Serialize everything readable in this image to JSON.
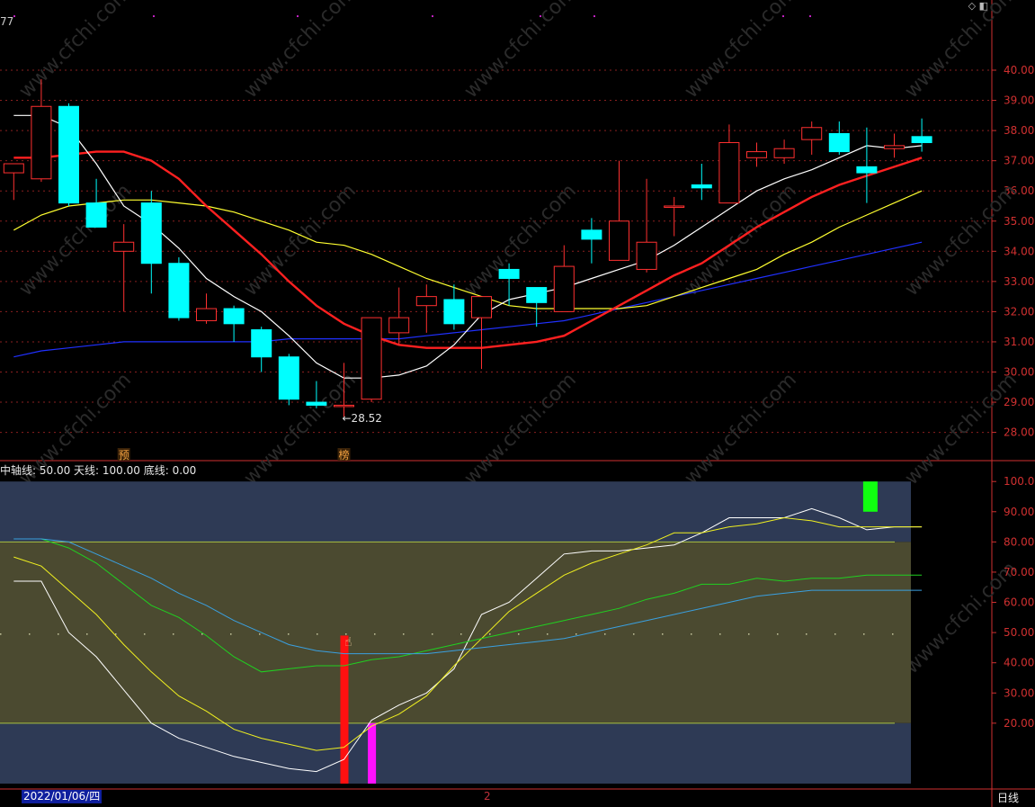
{
  "indicator_header": {
    "middle": "中轴线: 50.00",
    "top": "天线: 100.00",
    "bottom": "底线: 0.00"
  },
  "top_left_text": "77",
  "date_label": "2022/01/06/四",
  "period_label": "日线",
  "bottom_mid_label": "2",
  "window_icons": "◇ ◧",
  "watermark": "www.cfchi.com",
  "colors": {
    "up": "#ff3030",
    "down": "#00ffff",
    "ma5": "#ffffff",
    "ma10": "#ff2020",
    "ma20": "#ffff30",
    "ma60": "#2030ff",
    "grid": "#8a1f1f",
    "axis": "#d03030",
    "zone_band": "#2e3a55",
    "zone_mid": "#4b4a30"
  },
  "chart_data": [
    {
      "type": "candlestick",
      "ylim": [
        27.5,
        40.8
      ],
      "yticks": [
        "28.00",
        "29.00",
        "30.00",
        "31.00",
        "32.00",
        "33.00",
        "34.00",
        "35.00",
        "36.00",
        "37.00",
        "38.00",
        "39.00",
        "40.00"
      ],
      "candles": [
        {
          "o": 36.6,
          "h": 36.6,
          "l": 35.7,
          "c": 36.9
        },
        {
          "o": 36.4,
          "h": 39.7,
          "l": 36.3,
          "c": 38.8
        },
        {
          "o": 38.8,
          "h": 38.9,
          "l": 35.5,
          "c": 35.6
        },
        {
          "o": 35.6,
          "h": 36.4,
          "l": 34.8,
          "c": 34.8
        },
        {
          "o": 34.0,
          "h": 34.9,
          "l": 32.0,
          "c": 34.3
        },
        {
          "o": 35.6,
          "h": 36.0,
          "l": 32.6,
          "c": 33.6
        },
        {
          "o": 33.6,
          "h": 33.8,
          "l": 31.7,
          "c": 31.8
        },
        {
          "o": 31.7,
          "h": 32.6,
          "l": 31.6,
          "c": 32.1
        },
        {
          "o": 32.1,
          "h": 32.2,
          "l": 31.0,
          "c": 31.6
        },
        {
          "o": 31.4,
          "h": 31.5,
          "l": 30.0,
          "c": 30.5
        },
        {
          "o": 30.5,
          "h": 30.6,
          "l": 28.9,
          "c": 29.1
        },
        {
          "o": 29.0,
          "h": 29.7,
          "l": 28.8,
          "c": 28.9
        },
        {
          "o": 28.9,
          "h": 30.3,
          "l": 28.52,
          "c": 28.9
        },
        {
          "o": 29.1,
          "h": 31.8,
          "l": 29.0,
          "c": 31.8
        },
        {
          "o": 31.3,
          "h": 32.8,
          "l": 30.9,
          "c": 31.8
        },
        {
          "o": 32.2,
          "h": 32.9,
          "l": 31.3,
          "c": 32.5
        },
        {
          "o": 32.4,
          "h": 32.9,
          "l": 31.4,
          "c": 31.6
        },
        {
          "o": 31.8,
          "h": 32.5,
          "l": 30.1,
          "c": 32.5
        },
        {
          "o": 33.4,
          "h": 33.6,
          "l": 32.2,
          "c": 33.1
        },
        {
          "o": 32.8,
          "h": 32.8,
          "l": 31.5,
          "c": 32.3
        },
        {
          "o": 32.0,
          "h": 34.2,
          "l": 32.0,
          "c": 33.5
        },
        {
          "o": 34.7,
          "h": 35.1,
          "l": 33.6,
          "c": 34.4
        },
        {
          "o": 33.7,
          "h": 37.0,
          "l": 33.7,
          "c": 35.0
        },
        {
          "o": 33.4,
          "h": 36.4,
          "l": 33.3,
          "c": 34.3
        },
        {
          "o": 35.5,
          "h": 35.8,
          "l": 34.5,
          "c": 35.5
        },
        {
          "o": 36.2,
          "h": 36.9,
          "l": 35.7,
          "c": 36.1
        },
        {
          "o": 35.6,
          "h": 38.2,
          "l": 35.6,
          "c": 37.6
        },
        {
          "o": 37.1,
          "h": 37.6,
          "l": 36.8,
          "c": 37.3
        },
        {
          "o": 37.1,
          "h": 37.7,
          "l": 36.9,
          "c": 37.4
        },
        {
          "o": 37.7,
          "h": 38.3,
          "l": 37.2,
          "c": 38.1
        },
        {
          "o": 37.9,
          "h": 38.3,
          "l": 37.2,
          "c": 37.3
        },
        {
          "o": 36.8,
          "h": 38.1,
          "l": 35.6,
          "c": 36.6
        },
        {
          "o": 37.4,
          "h": 37.9,
          "l": 37.1,
          "c": 37.5
        },
        {
          "o": 37.8,
          "h": 38.4,
          "l": 37.3,
          "c": 37.6
        }
      ],
      "ma5": [
        38.5,
        38.5,
        38.1,
        36.9,
        35.5,
        34.9,
        34.1,
        33.1,
        32.5,
        32.0,
        31.2,
        30.3,
        29.8,
        29.8,
        29.9,
        30.2,
        30.9,
        31.9,
        32.4,
        32.6,
        32.8,
        33.1,
        33.4,
        33.7,
        34.2,
        34.8,
        35.4,
        36.0,
        36.4,
        36.7,
        37.1,
        37.5,
        37.4,
        37.5
      ],
      "ma10": [
        37.1,
        37.1,
        37.2,
        37.3,
        37.3,
        37.0,
        36.4,
        35.5,
        34.7,
        33.9,
        33.0,
        32.2,
        31.6,
        31.2,
        30.9,
        30.8,
        30.8,
        30.8,
        30.9,
        31.0,
        31.2,
        31.7,
        32.2,
        32.7,
        33.2,
        33.6,
        34.2,
        34.8,
        35.3,
        35.8,
        36.2,
        36.5,
        36.8,
        37.1
      ],
      "ma20": [
        34.7,
        35.2,
        35.5,
        35.6,
        35.7,
        35.7,
        35.6,
        35.5,
        35.3,
        35.0,
        34.7,
        34.3,
        34.2,
        33.9,
        33.5,
        33.1,
        32.8,
        32.5,
        32.2,
        32.1,
        32.1,
        32.1,
        32.1,
        32.2,
        32.5,
        32.8,
        33.1,
        33.4,
        33.9,
        34.3,
        34.8,
        35.2,
        35.6,
        36.0
      ],
      "ma60": [
        30.5,
        30.7,
        30.8,
        30.9,
        31.0,
        31.0,
        31.0,
        31.0,
        31.0,
        31.0,
        31.1,
        31.1,
        31.1,
        31.1,
        31.1,
        31.2,
        31.3,
        31.4,
        31.5,
        31.6,
        31.7,
        31.9,
        32.1,
        32.3,
        32.5,
        32.7,
        32.9,
        33.1,
        33.3,
        33.5,
        33.7,
        33.9,
        34.1,
        34.3
      ],
      "low_label": "←28.52",
      "badges": [
        {
          "index": 4,
          "text": "预"
        },
        {
          "index": 12,
          "text": "榜"
        }
      ]
    },
    {
      "type": "line",
      "ylim": [
        0,
        100
      ],
      "yticks": [
        "20.00",
        "30.00",
        "40.00",
        "50.00",
        "60.00",
        "70.00",
        "80.00",
        "90.00",
        "100.00"
      ],
      "zones": {
        "top": 100,
        "upper": 80,
        "lower": 20,
        "bottom": 0
      },
      "series": [
        {
          "color": "#ffffff",
          "values": [
            67,
            67,
            50,
            42,
            31,
            20,
            15,
            12,
            9,
            7,
            5,
            4,
            8,
            21,
            26,
            30,
            38,
            56,
            60,
            68,
            76,
            77,
            77,
            78,
            79,
            83,
            88,
            88,
            88,
            91,
            88,
            84,
            85,
            85
          ]
        },
        {
          "color": "#f0f020",
          "values": [
            75,
            72,
            64,
            56,
            46,
            37,
            29,
            24,
            18,
            15,
            13,
            11,
            12,
            19,
            23,
            29,
            39,
            48,
            57,
            63,
            69,
            73,
            76,
            79,
            83,
            83,
            85,
            86,
            88,
            87,
            85,
            85,
            85,
            85
          ]
        },
        {
          "color": "#20d020",
          "values": [
            81,
            81,
            78,
            73,
            66,
            59,
            55,
            49,
            42,
            37,
            38,
            39,
            39,
            41,
            42,
            44,
            46,
            48,
            50,
            52,
            54,
            56,
            58,
            61,
            63,
            66,
            66,
            68,
            67,
            68,
            68,
            69,
            69,
            69
          ]
        },
        {
          "color": "#3aa0e0",
          "values": [
            81,
            81,
            80,
            76,
            72,
            68,
            63,
            59,
            54,
            50,
            46,
            44,
            43,
            43,
            43,
            43,
            44,
            45,
            46,
            47,
            48,
            50,
            52,
            54,
            56,
            58,
            60,
            62,
            63,
            64,
            64,
            64,
            64,
            64
          ]
        }
      ],
      "bars": [
        {
          "index": 12,
          "from": 0,
          "to": 49,
          "color": "#ff1010"
        },
        {
          "index": 13,
          "from": 0,
          "to": 20,
          "color": "#ff10ff"
        },
        {
          "index": 31,
          "from": 90,
          "to": 100,
          "color": "#10ff10"
        }
      ]
    }
  ]
}
